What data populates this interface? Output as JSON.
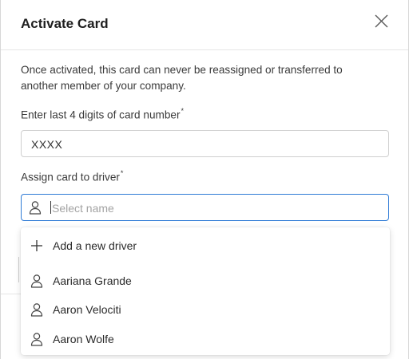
{
  "modal": {
    "title": "Activate Card",
    "description": "Once activated, this card can never be reassigned or transferred to another member of your company."
  },
  "card_field": {
    "label": "Enter last 4 digits of card number",
    "required_mark": "*",
    "value": "XXXX"
  },
  "driver_field": {
    "label": "Assign card to driver",
    "required_mark": "*",
    "placeholder": "Select name"
  },
  "dropdown": {
    "add_label": "Add a new driver",
    "drivers": [
      "Aariana Grande",
      "Aaron Velociti",
      "Aaron Wolfe"
    ]
  },
  "colors": {
    "focus_border": "#2f7bd6",
    "placeholder": "#a3a3a3"
  }
}
